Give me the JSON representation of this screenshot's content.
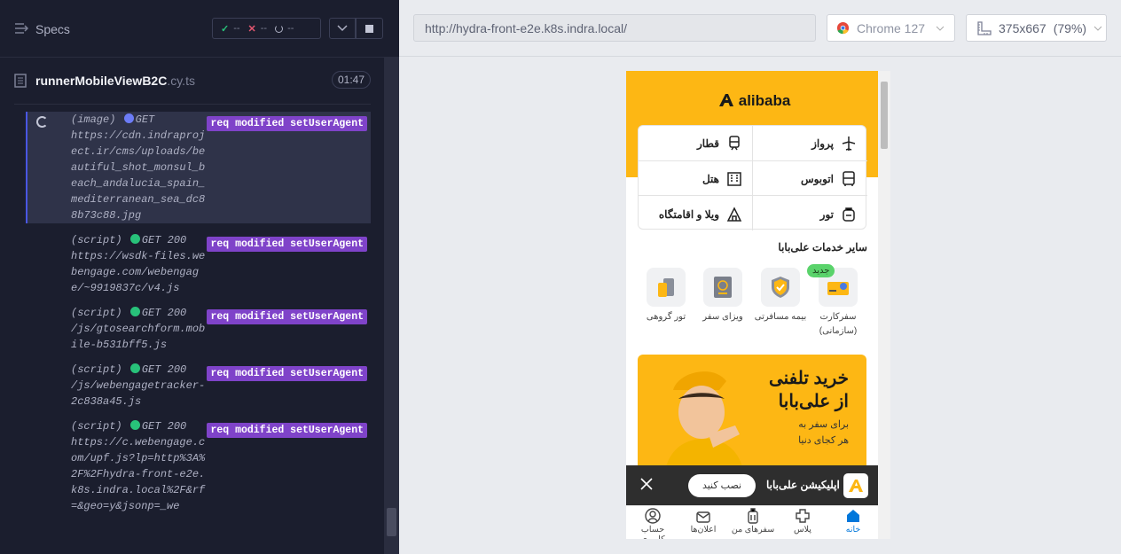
{
  "runner": {
    "specs_label": "Specs",
    "passed": "--",
    "failed": "--",
    "pending": "--",
    "file_name": "runnerMobileViewB2C",
    "file_ext": ".cy.ts",
    "duration": "01:47",
    "log": [
      {
        "kind": "(image)",
        "method": "GET",
        "status": "",
        "url": "https://cdn.indraproject.ir/cms/uploads/beautiful_shot_monsul_beach_andalucia_spain_mediterranean_sea_dc88b73c88.jpg",
        "badge": "req modified setUserAgent",
        "dot": "#6c7cf6",
        "active": true
      },
      {
        "kind": "(script)",
        "method": "GET",
        "status": "200",
        "url": "https://wsdk-files.webengage.com/webengage/~9919837c/v4.js",
        "badge": "req modified setUserAgent",
        "dot": "#28c27a"
      },
      {
        "kind": "(script)",
        "method": "GET",
        "status": "200",
        "url": "/js/gtosearchform.mobile-b531bff5.js",
        "badge": "req modified setUserAgent",
        "dot": "#28c27a"
      },
      {
        "kind": "(script)",
        "method": "GET",
        "status": "200",
        "url": "/js/webengagetracker-2c838a45.js",
        "badge": "req modified setUserAgent",
        "dot": "#28c27a"
      },
      {
        "kind": "(script)",
        "method": "GET",
        "status": "200",
        "url": "https://c.webengage.com/upf.js?lp=http%3A%2F%2Fhydra-front-e2e.k8s.indra.local%2F&rf=&geo=y&jsonp=_we",
        "badge": "req modified setUserAgent",
        "dot": "#28c27a"
      }
    ]
  },
  "browser_bar": {
    "url": "http://hydra-front-e2e.k8s.indra.local/",
    "browser": "Chrome 127",
    "viewport": "375x667",
    "zoom": "(79%)"
  },
  "app": {
    "logo": "alibaba",
    "grid": [
      {
        "label": "پرواز",
        "icon": "plane-icon"
      },
      {
        "label": "قطار",
        "icon": "train-icon"
      },
      {
        "label": "اتوبوس",
        "icon": "bus-icon"
      },
      {
        "label": "هتل",
        "icon": "hotel-icon"
      },
      {
        "label": "تور",
        "icon": "tour-icon"
      },
      {
        "label": "ویلا و اقامتگاه",
        "icon": "villa-icon"
      }
    ],
    "other_title": "سایر خدمات علی‌بابا",
    "services": [
      {
        "label": "سفرکارت",
        "sub": "(سازمانی)",
        "icon": "travel-card-icon"
      },
      {
        "label": "بیمه مسافرتی",
        "sub": "",
        "icon": "insurance-icon"
      },
      {
        "label": "ویزای سفر",
        "sub": "",
        "icon": "visa-icon"
      },
      {
        "label": "تور گروهی",
        "sub": "",
        "icon": "group-tour-icon"
      }
    ],
    "new_badge": "جدید",
    "banner": {
      "line1": "خرید تلفنی",
      "line2": "از علی‌بابا",
      "line3": "برای سفر به",
      "line4": "هر کجای دنیا"
    },
    "app_bar": {
      "install": "نصب کنید",
      "name": "اپلیکیشن علی‌بابا"
    },
    "bottom_nav": [
      {
        "label": "خانه",
        "icon": "home-icon",
        "active": true
      },
      {
        "label": "پلاس",
        "icon": "plus-icon"
      },
      {
        "label": "سفرهای من",
        "icon": "trips-icon"
      },
      {
        "label": "اعلان‌ها",
        "icon": "notifications-icon"
      },
      {
        "label": "حساب کاربری",
        "icon": "account-icon"
      }
    ],
    "colors": {
      "brand": "#fdb714",
      "active_nav": "#0077db"
    }
  }
}
